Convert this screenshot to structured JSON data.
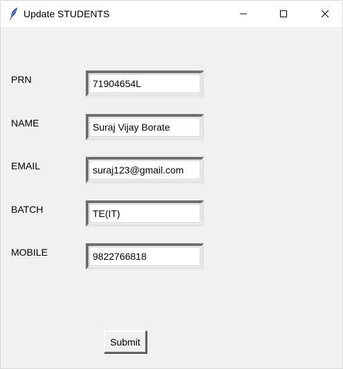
{
  "window": {
    "title": "Update STUDENTS",
    "app_icon": "feather-icon",
    "controls": [
      "minimize-icon",
      "maximize-icon",
      "close-icon"
    ]
  },
  "form": {
    "prn": {
      "label": "PRN",
      "value": "71904654L"
    },
    "name": {
      "label": "NAME",
      "value": "Suraj Vijay Borate"
    },
    "email": {
      "label": "EMAIL",
      "value": "suraj123@gmail.com"
    },
    "batch": {
      "label": "BATCH",
      "value": "TE(IT)"
    },
    "mobile": {
      "label": "MOBILE",
      "value": "9822766818"
    },
    "submit_label": "Submit"
  },
  "colors": {
    "window_bg": "#f0f0f0",
    "titlebar_bg": "#ffffff",
    "entry_shadow_dark": "#6f6f6f",
    "entry_shadow_light": "#e3e3e3"
  }
}
